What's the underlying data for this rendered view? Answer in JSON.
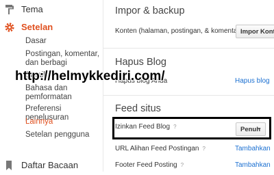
{
  "sidebar": {
    "items": [
      {
        "label": "Tema",
        "icon": "paint-roller-icon"
      },
      {
        "label": "Setelan",
        "icon": "gear-icon"
      },
      {
        "label": "Daftar Bacaan",
        "icon": "bookmark-icon"
      }
    ],
    "subitems": [
      {
        "label": "Dasar"
      },
      {
        "label": "Postingan, komentar, dan berbagi"
      },
      {
        "label": "Email"
      },
      {
        "label": "Bahasa dan pemformatan"
      },
      {
        "label": "Preferensi penelusuran"
      },
      {
        "label": "Lainnya"
      },
      {
        "label": "Setelan pengguna"
      }
    ],
    "accent_color": "#e0501f"
  },
  "main": {
    "import_backup": {
      "title": "Impor & backup",
      "content_label": "Konten (halaman, postingan, & komentar)",
      "import_button": "Impor Konten"
    },
    "delete_blog": {
      "title": "Hapus Blog",
      "row_label": "Hapus blog Anda",
      "link": "Hapus blog"
    },
    "feed": {
      "title": "Feed situs",
      "allow_label": "Izinkan Feed Blog",
      "allow_value": "Penuh",
      "redirect_label": "URL Alihan Feed Postingan",
      "redirect_link": "Tambahkan",
      "footer_label": "Footer Feed Posting",
      "footer_link": "Tambahkan",
      "help": "?"
    }
  },
  "watermark": "http://helmykkediri.com/",
  "link_color": "#1a6fd1"
}
